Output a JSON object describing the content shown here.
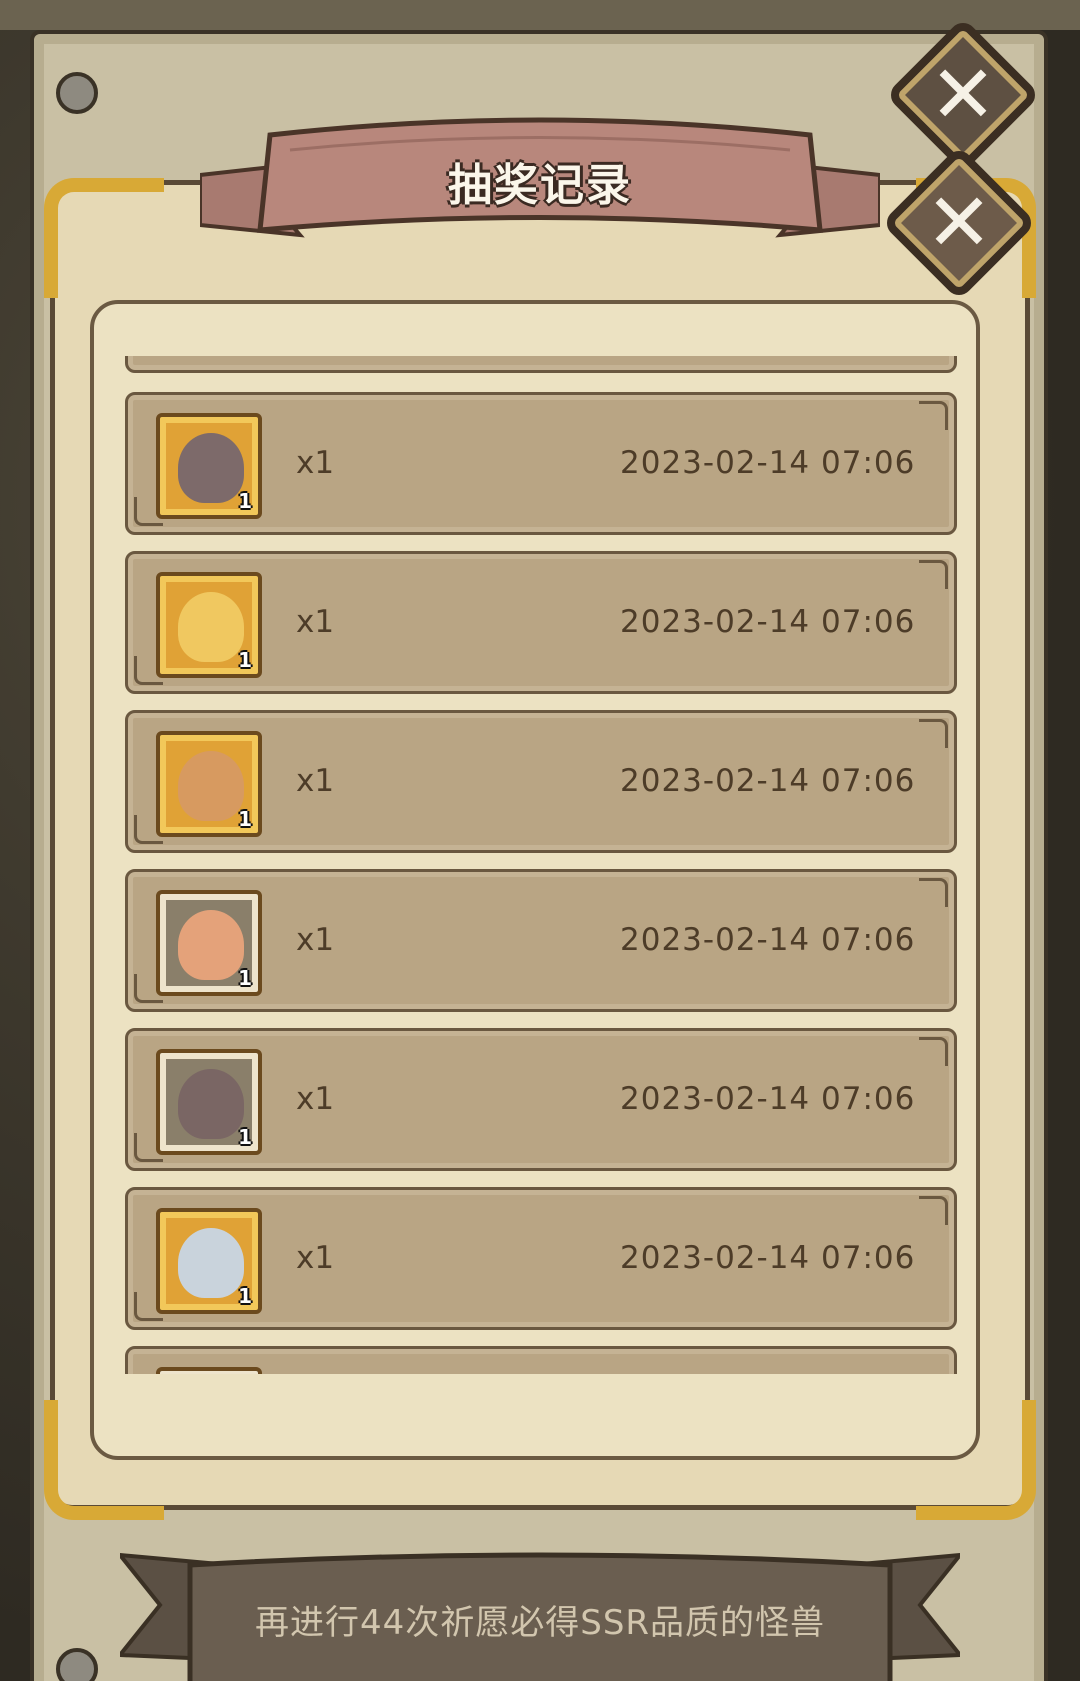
{
  "title": "抽奖记录",
  "close_icon_glyph": "✕",
  "records": [
    {
      "qty": "x1",
      "time": "2023-02-14 07:06",
      "count": "1",
      "frame": "gold",
      "face_color": "#7d6a6a",
      "icon": "stone-golem-avatar-icon"
    },
    {
      "qty": "x1",
      "time": "2023-02-14 07:06",
      "count": "1",
      "frame": "gold",
      "face_color": "#f0c860",
      "icon": "blonde-girl-avatar-icon"
    },
    {
      "qty": "x1",
      "time": "2023-02-14 07:06",
      "count": "1",
      "frame": "gold",
      "face_color": "#d79a60",
      "icon": "brown-hair-girl-avatar-icon"
    },
    {
      "qty": "x1",
      "time": "2023-02-14 07:06",
      "count": "1",
      "frame": "plain",
      "face_color": "#e4a27a",
      "icon": "salamander-avatar-icon"
    },
    {
      "qty": "x1",
      "time": "2023-02-14 07:06",
      "count": "1",
      "frame": "plain",
      "face_color": "#7a6664",
      "icon": "toad-avatar-icon"
    },
    {
      "qty": "x1",
      "time": "2023-02-14 07:06",
      "count": "1",
      "frame": "gold",
      "face_color": "#c9d3dc",
      "icon": "silver-hair-avatar-icon"
    }
  ],
  "footer_text": "再进行44次祈愿必得SSR品质的怪兽",
  "colors": {
    "ribbon": "#b8877c",
    "gold_frame": "#d8a936",
    "record_bg": "#b9a584",
    "text": "#4d3c28"
  }
}
